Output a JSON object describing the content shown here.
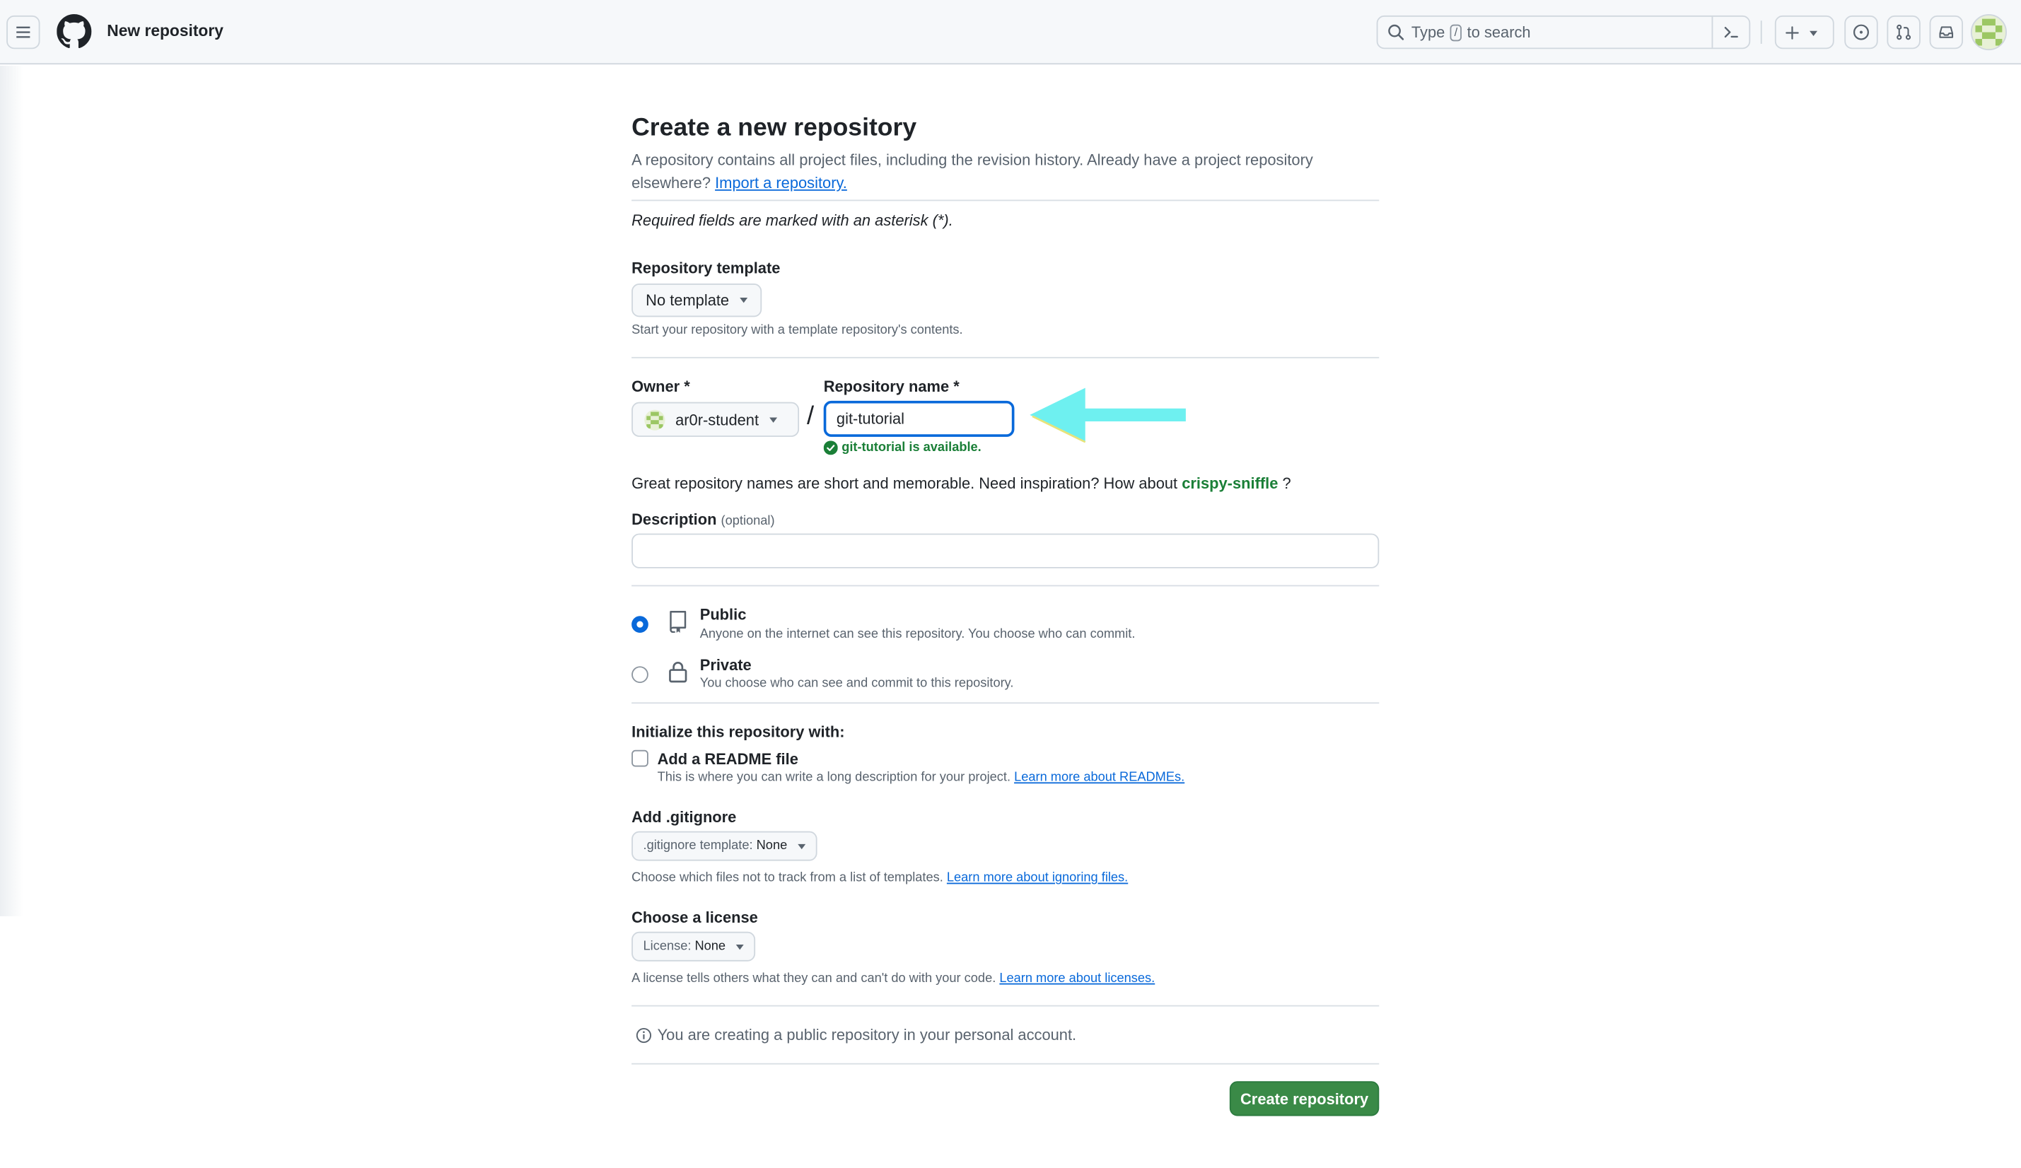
{
  "header": {
    "title": "New repository",
    "search_prefix": "Type",
    "search_key": "/",
    "search_suffix": "to search"
  },
  "page": {
    "heading": "Create a new repository",
    "intro": "A repository contains all project files, including the revision history. Already have a project repository elsewhere?",
    "import_link": "Import a repository.",
    "required_note": "Required fields are marked with an asterisk (*)."
  },
  "template": {
    "label": "Repository template",
    "selected": "No template",
    "hint": "Start your repository with a template repository's contents."
  },
  "owner": {
    "label": "Owner *",
    "value": "ar0r-student"
  },
  "separator": "/",
  "repo_name": {
    "label": "Repository name *",
    "value": "git-tutorial",
    "availability": "git-tutorial is available."
  },
  "suggestion": {
    "text": "Great repository names are short and memorable. Need inspiration? How about",
    "name": "crispy-sniffle",
    "end": "?"
  },
  "description": {
    "label": "Description",
    "optional": "(optional)",
    "value": ""
  },
  "visibility": {
    "public_label": "Public",
    "public_desc": "Anyone on the internet can see this repository. You choose who can commit.",
    "private_label": "Private",
    "private_desc": "You choose who can see and commit to this repository.",
    "selected": "Public"
  },
  "initialize": {
    "heading": "Initialize this repository with:",
    "readme_label": "Add a README file",
    "readme_desc": "This is where you can write a long description for your project.",
    "readme_link": "Learn more about READMEs.",
    "readme_checked": false
  },
  "gitignore": {
    "label": "Add .gitignore",
    "button_prefix": ".gitignore template:",
    "button_value": "None",
    "hint": "Choose which files not to track from a list of templates.",
    "link": "Learn more about ignoring files."
  },
  "license": {
    "label": "Choose a license",
    "button_prefix": "License:",
    "button_value": "None",
    "hint": "A license tells others what they can and can't do with your code.",
    "link": "Learn more about licenses."
  },
  "info": "You are creating a public repository in your personal account.",
  "submit_label": "Create repository",
  "colors": {
    "primary_button": "#3a8a47",
    "link": "#0969da",
    "success": "#1a7f37",
    "annotation_arrow": "#6ef0f0"
  }
}
